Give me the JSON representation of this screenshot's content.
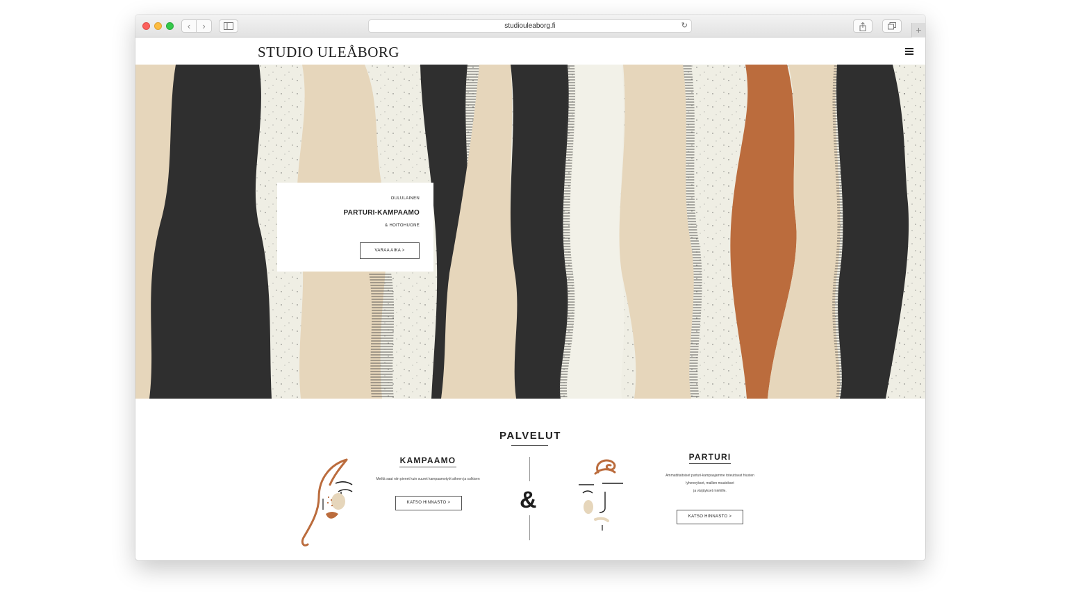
{
  "browser": {
    "url": "studiouleaborg.fi",
    "back_glyph": "‹",
    "forward_glyph": "›",
    "reload_glyph": "↻",
    "new_tab_glyph": "+",
    "icons": [
      "back-icon",
      "forward-icon",
      "sidebar-icon",
      "reload-icon",
      "share-icon",
      "tabs-icon",
      "new-tab-icon"
    ]
  },
  "site": {
    "logo": "STUDIO ULEÅBORG",
    "menu_icon": "hamburger-menu-icon"
  },
  "hero": {
    "kicker": "OULULAINEN",
    "title": "PARTURI-KAMPAAMO",
    "subtitle": "& HOITOHUONE",
    "button_label": "VARAA AIKA >",
    "colors": {
      "background": "#eeece2",
      "dark": "#2f2f2f",
      "beige": "#e6d6bb",
      "orange": "#bb6c3d"
    }
  },
  "services": {
    "title": "PALVELUT",
    "ampersand": "&",
    "left": {
      "title": "KAMPAAMO",
      "description": "Meiltä saat niin pienet kuin suuret kampaamotyöt aikeen ja sulkisen",
      "button_label": "KATSO HINNASTO >",
      "icon": "woman-face-illustration-icon"
    },
    "right": {
      "title": "PARTURI",
      "description_lines": [
        "Ammattitaitoiset parturi-kampaajamme toteuttavat hiusten",
        "lyhennykset, mallien muutokset",
        "ja värjäykset miehille."
      ],
      "button_label": "KATSO HINNASTO >",
      "icon": "man-face-illustration-icon"
    }
  }
}
